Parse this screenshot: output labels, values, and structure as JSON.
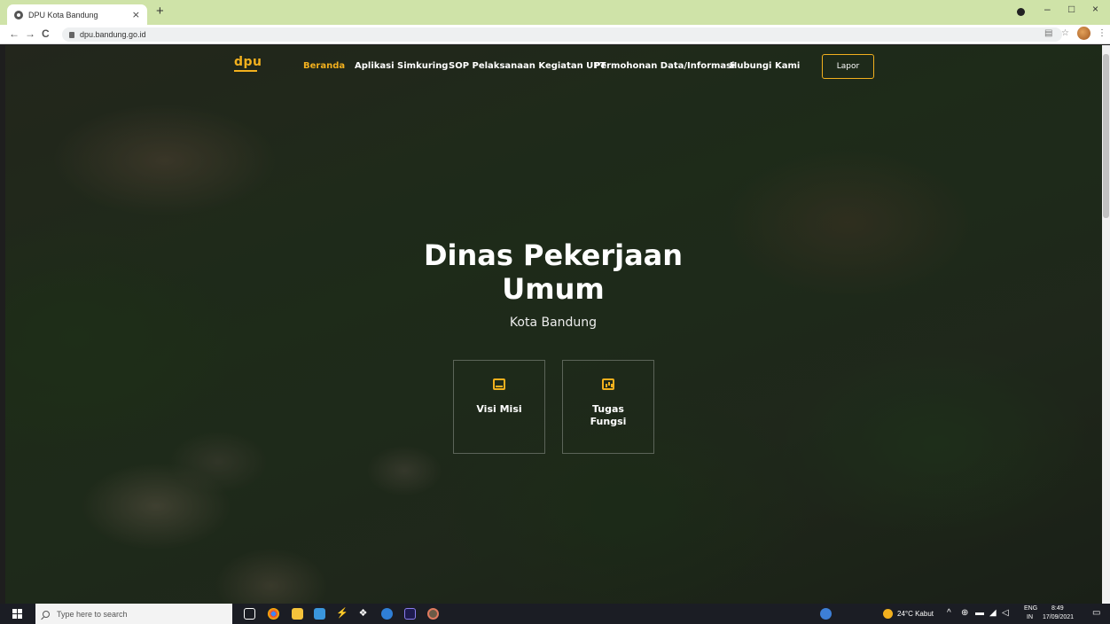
{
  "browser": {
    "tab_title": "DPU Kota Bandung",
    "tab_close": "×",
    "new_tab": "+",
    "url": "dpu.bandung.go.id",
    "back": "←",
    "forward": "→",
    "reload": "C",
    "minimize": "–",
    "maximize": "□",
    "close": "×",
    "star": "☆",
    "menu": "⋮",
    "translate": "▤"
  },
  "site": {
    "logo": "dpu",
    "nav": [
      {
        "label": "Beranda",
        "active": true
      },
      {
        "label": "Aplikasi Simkuring",
        "active": false
      },
      {
        "label": "SOP Pelaksanaan Kegiatan UPT",
        "active": false
      },
      {
        "label": "Permohonan Data/Informasi",
        "active": false
      },
      {
        "label": "Hubungi Kami",
        "active": false
      }
    ],
    "lapor_label": "Lapor",
    "accent_color": "#f2b01e"
  },
  "hero": {
    "title_line1": "Dinas Pekerjaan",
    "title_line2": "Umum",
    "subtitle": "Kota Bandung",
    "cards": [
      {
        "label": "Visi Misi",
        "icon": "store-icon"
      },
      {
        "label": "Tugas Fungsi",
        "icon": "bar-chart-icon"
      }
    ]
  },
  "taskbar": {
    "search_placeholder": "Type here to search",
    "weather": "24°C Kabut",
    "lang": "ENG",
    "region": "IN",
    "time": "8:49",
    "date": "17/09/2021"
  }
}
